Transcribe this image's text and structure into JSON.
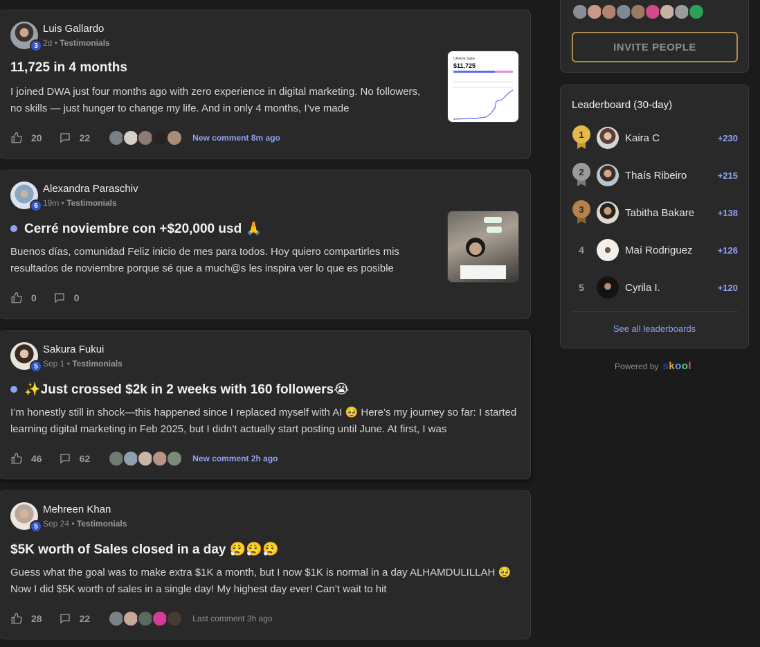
{
  "posts": [
    {
      "author": "Luis Gallardo",
      "level": "3",
      "time": "2d",
      "category": "Testimonials",
      "title": "11,725 in 4 months",
      "unread": false,
      "body": "I joined DWA just four months ago with zero experience in digital marketing. No followers, no skills — just hunger to change my life. And in only 4 months, I’ve made",
      "likes": "20",
      "comments": "22",
      "comment_status": "New comment 8m ago",
      "thumbnail": {
        "label": "Lifetime Sales",
        "value": "$11,725"
      }
    },
    {
      "author": "Alexandra Paraschiv",
      "level": "6",
      "time": "19m",
      "category": "Testimonials",
      "title": "Cerré noviembre con +$20,000 usd 🙏",
      "unread": true,
      "body": "Buenos días, comunidad Feliz inicio de mes para todos. Hoy quiero compartirles mis resultados de noviembre porque sé que a much@s les inspira ver lo que es posible",
      "likes": "0",
      "comments": "0",
      "comment_status": ""
    },
    {
      "author": "Sakura Fukui",
      "level": "5",
      "time": "Sep 1",
      "category": "Testimonials",
      "title": "✨Just crossed $2k in 2 weeks with 160 followers😭",
      "unread": true,
      "body": "I’m honestly still in shock—this happened since I replaced myself with AI 🥹 Here’s my journey so far: I started learning digital marketing in Feb 2025, but I didn’t actually start posting until June. At first, I was",
      "likes": "46",
      "comments": "62",
      "comment_status": "New comment 2h ago"
    },
    {
      "author": "Mehreen Khan",
      "level": "5",
      "time": "Sep 24",
      "category": "Testimonials",
      "title": "$5K worth of Sales closed in a day 😮‍💨😮‍💨😮‍💨",
      "unread": false,
      "body": "Guess what the goal was to make extra $1K a month, but I now $1K is normal in a day ALHAMDULILLAH 🥹 Now I did $5K worth of sales in a single day! My highest day ever! Can’t wait to hit",
      "likes": "28",
      "comments": "22",
      "comment_status": "Last comment 3h ago"
    }
  ],
  "sidebar": {
    "invite_label": "INVITE PEOPLE",
    "leaderboard_title": "Leaderboard (30-day)",
    "leaders": [
      {
        "rank": "1",
        "name": "Kaira C",
        "points": "+230"
      },
      {
        "rank": "2",
        "name": "Thaís Ribeiro",
        "points": "+215"
      },
      {
        "rank": "3",
        "name": "Tabitha Bakare",
        "points": "+138"
      },
      {
        "rank": "4",
        "name": "Maí Rodriguez",
        "points": "+126"
      },
      {
        "rank": "5",
        "name": "Cyrila I.",
        "points": "+120"
      }
    ],
    "see_all_label": "See all leaderboards"
  },
  "footer": {
    "powered_by": "Powered by",
    "brand": "skool"
  },
  "colors": {
    "accent": "#8ea3f2",
    "gold": "#e3b94a",
    "silver": "#9a9a9a",
    "bronze": "#b5824a",
    "level_badge": "#3653c8"
  }
}
